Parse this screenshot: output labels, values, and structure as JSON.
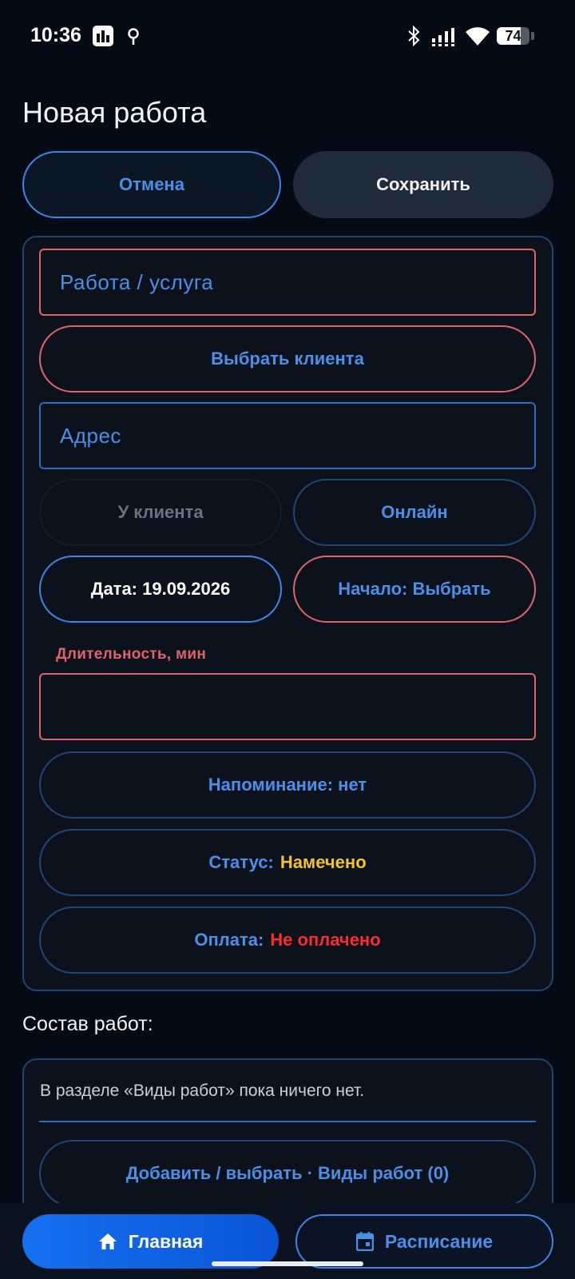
{
  "status_bar": {
    "time": "10:36",
    "battery": "74",
    "battery_level": 0.74
  },
  "header": {
    "title": "Новая работа",
    "cancel_label": "Отмена",
    "save_label": "Сохранить"
  },
  "form": {
    "service_placeholder": "Работа / услуга",
    "client_button": "Выбрать клиента",
    "address_placeholder": "Адрес",
    "location_options": [
      "У клиента",
      "Онлайн"
    ],
    "date_button": "Дата: 19.09.2026",
    "start_button": "Начало: Выбрать",
    "duration_label": "Длительность, мин",
    "duration_value": "",
    "reminder_button": "Напоминание: нет",
    "status": {
      "label": "Статус:",
      "value": "Намечено",
      "value_color": "#f0c232"
    },
    "payment": {
      "label": "Оплата:",
      "value": "Не оплачено",
      "value_color": "#ff2b2b"
    }
  },
  "composition": {
    "title": "Состав работ:",
    "empty_text": "В разделе «Виды работ» пока ничего нет.",
    "add_button": "Добавить / выбрать · Виды работ (0)"
  },
  "bottom_nav": {
    "home_label": "Главная",
    "home_icon": "home-icon",
    "schedule_label": "Расписание",
    "schedule_icon": "calendar-icon"
  },
  "colors": {
    "accent": "#4a8fe8",
    "error": "#e0636b",
    "background": "#050b14"
  }
}
